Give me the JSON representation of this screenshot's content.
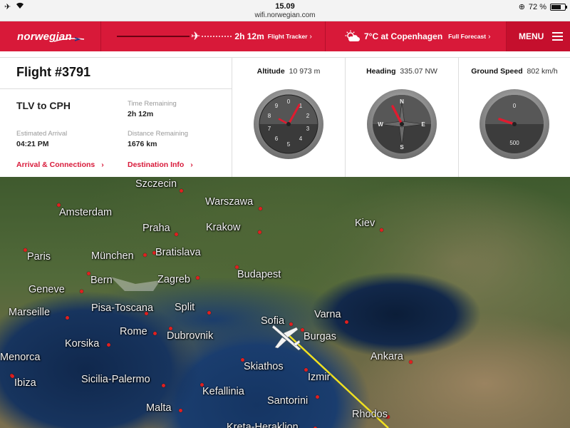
{
  "status_bar": {
    "time": "15.09",
    "url": "wifi.norwegian.com",
    "battery": "72 %",
    "battery_level": 0.72
  },
  "nav": {
    "logo": "norwegian",
    "tracker_time": "2h 12m",
    "tracker_link": "Flight Tracker",
    "weather_temp": "7°C at Copenhagen",
    "weather_link": "Full Forecast",
    "menu_label": "MENU"
  },
  "flight": {
    "title": "Flight #3791",
    "route": "TLV to CPH",
    "time_remaining_label": "Time Remaining",
    "time_remaining": "2h 12m",
    "estimated_arrival_label": "Estimated Arrival",
    "estimated_arrival": "04:21 PM",
    "distance_remaining_label": "Distance Remaining",
    "distance_remaining": "1676 km",
    "arrival_link": "Arrival & Connections",
    "destination_link": "Destination Info"
  },
  "gauges": {
    "altitude_label": "Altitude",
    "altitude_value": "10 973 m",
    "heading_label": "Heading",
    "heading_value": "335.07 NW",
    "speed_label": "Ground Speed",
    "speed_value": "802 km/h",
    "altimeter_ticks": [
      "0",
      "1",
      "2",
      "3",
      "4",
      "5",
      "6",
      "7",
      "8",
      "9"
    ],
    "compass_points": [
      "N",
      "E",
      "S",
      "W"
    ],
    "speed_ticks": [
      "0",
      "500"
    ]
  },
  "map": {
    "cities": [
      "Szczecin",
      "Warszawa",
      "Amsterdam",
      "Praha",
      "Krakow",
      "Kiev",
      "Paris",
      "München",
      "Bratislava",
      "Budapest",
      "Bern",
      "Zagreb",
      "Geneve",
      "Marseille",
      "Pisa-Toscana",
      "Split",
      "Sofia",
      "Varna",
      "Rome",
      "Dubrovnik",
      "Burgas",
      "Korsika",
      "Menorca",
      "Ankara",
      "Skiathos",
      "Ibiza",
      "Sicilia-Palermo",
      "Izmir",
      "Kefallinia",
      "Santorini",
      "Malta",
      "Rhodos",
      "Kreta-Heraklion"
    ]
  }
}
